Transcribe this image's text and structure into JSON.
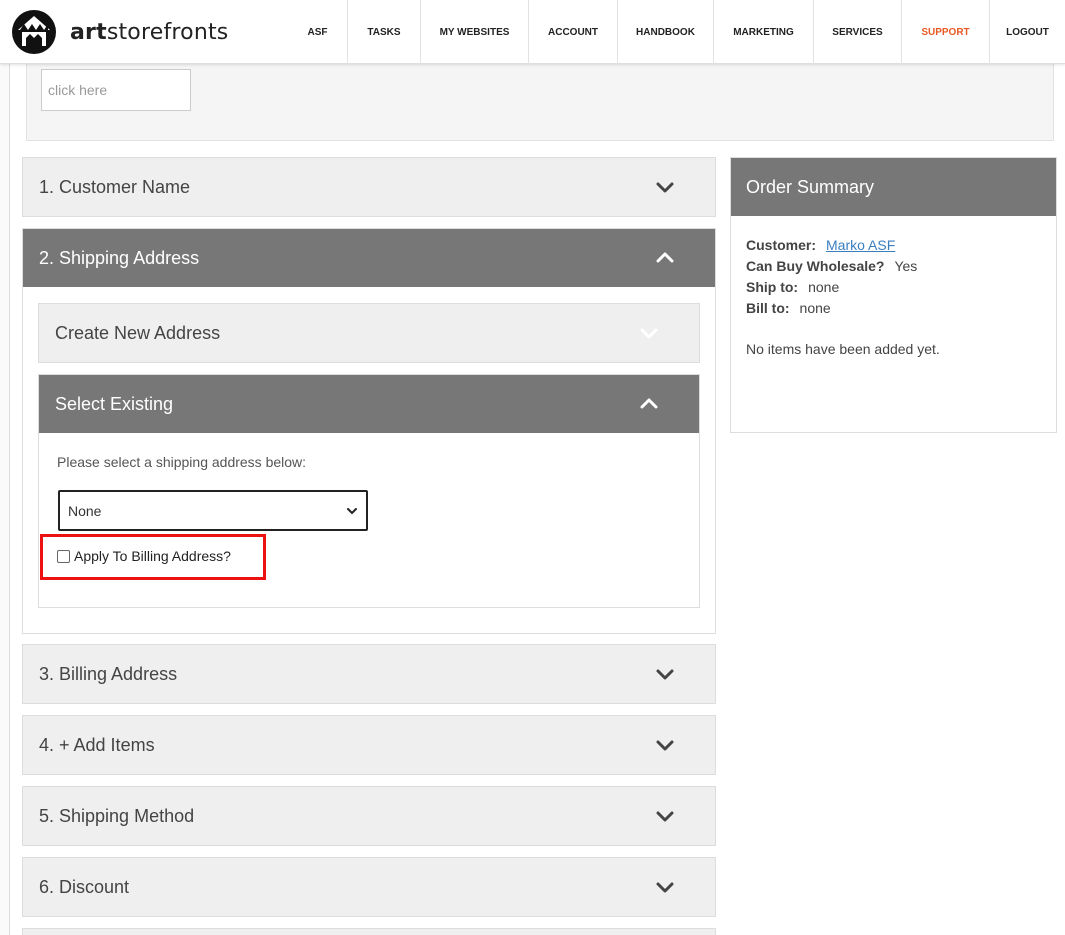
{
  "brand": {
    "logo_bold": "art",
    "logo_rest": "storefronts"
  },
  "nav": {
    "items": [
      {
        "label": "ASF"
      },
      {
        "label": "TASKS"
      },
      {
        "label": "MY WEBSITES"
      },
      {
        "label": "ACCOUNT"
      },
      {
        "label": "HANDBOOK"
      },
      {
        "label": "MARKETING"
      },
      {
        "label": "SERVICES"
      },
      {
        "label": "SUPPORT",
        "active": true
      },
      {
        "label": "LOGOUT"
      }
    ]
  },
  "top": {
    "input_placeholder": "click here"
  },
  "sections": {
    "customer_name": "1. Customer Name",
    "shipping_address": "2. Shipping Address",
    "billing_address": "3. Billing Address",
    "add_items": "4. + Add Items",
    "shipping_method": "5. Shipping Method",
    "discount": "6. Discount"
  },
  "shipping": {
    "create_new": "Create New Address",
    "select_existing": "Select Existing",
    "instruction": "Please select a shipping address below:",
    "selected_value": "None",
    "apply_billing_label": "Apply To Billing Address?",
    "apply_billing_checked": false
  },
  "summary": {
    "title": "Order Summary",
    "customer_label": "Customer:",
    "customer_value": "Marko ASF",
    "wholesale_label": "Can Buy Wholesale?",
    "wholesale_value": "Yes",
    "ship_label": "Ship to:",
    "ship_value": "none",
    "bill_label": "Bill to:",
    "bill_value": "none",
    "empty_text": "No items have been added yet."
  },
  "colors": {
    "accent": "#e85a24",
    "panel_open": "#777777",
    "highlight": "#ee1111",
    "link": "#3a7ec0"
  }
}
